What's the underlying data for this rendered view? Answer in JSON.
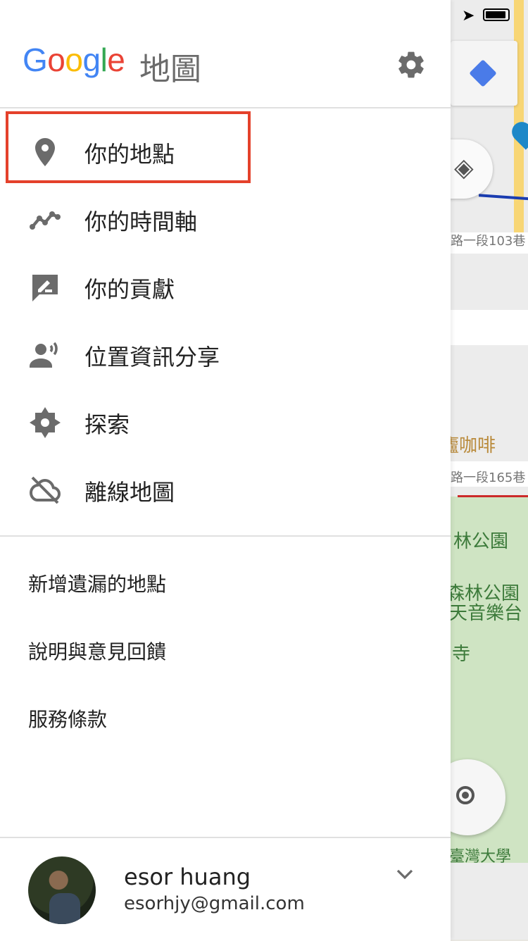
{
  "app": {
    "logo_letters": [
      "G",
      "o",
      "o",
      "g",
      "l",
      "e"
    ],
    "suffix": "地圖"
  },
  "menu": {
    "primary": [
      {
        "label": "你的地點",
        "icon": "place-pin-icon"
      },
      {
        "label": "你的時間軸",
        "icon": "timeline-icon"
      },
      {
        "label": "你的貢獻",
        "icon": "contributions-icon"
      },
      {
        "label": "位置資訊分享",
        "icon": "location-sharing-icon"
      },
      {
        "label": "探索",
        "icon": "explore-icon"
      },
      {
        "label": "離線地圖",
        "icon": "offline-cloud-icon"
      }
    ],
    "secondary": [
      {
        "label": "新增遺漏的地點"
      },
      {
        "label": "說明與意見回饋"
      },
      {
        "label": "服務條款"
      }
    ]
  },
  "account": {
    "name": "esor huang",
    "email": "esorhjy@gmail.com"
  },
  "map": {
    "labels": {
      "road1": "路一段103巷",
      "cafe": "廬咖啡",
      "road2": "路一段165巷",
      "park1": "林公園",
      "park2": "森林公園",
      "music": "天音樂台",
      "temple": "寺",
      "university": "臺灣大學"
    }
  },
  "colors": {
    "highlight": "#e4412b",
    "google_blue": "#4285f4",
    "google_red": "#ea4335",
    "google_yellow": "#fbbc05",
    "google_green": "#34a853",
    "icon_gray": "#6b6b6b",
    "park_green": "#cfe4c3"
  }
}
